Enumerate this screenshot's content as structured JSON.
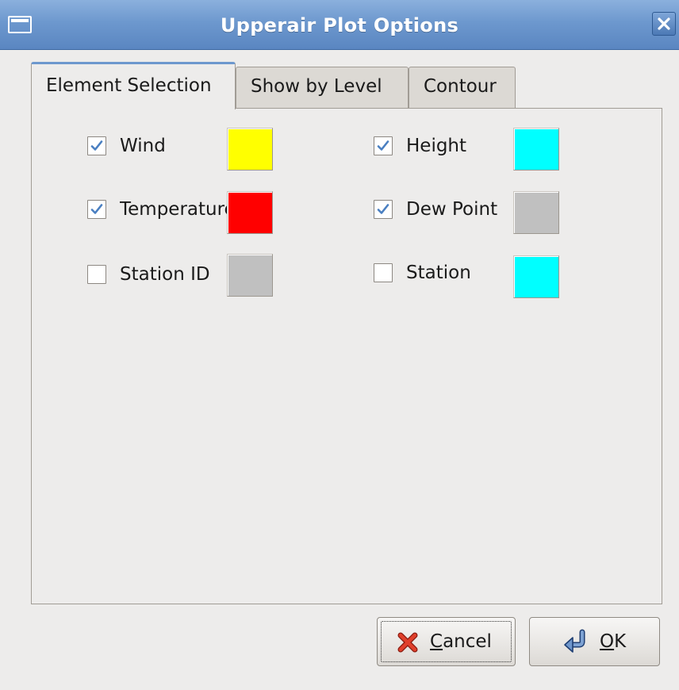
{
  "window": {
    "title": "Upperair Plot Options"
  },
  "tabs": [
    {
      "label": "Element Selection",
      "active": true
    },
    {
      "label": "Show by Level",
      "active": false
    },
    {
      "label": "Contour",
      "active": false
    }
  ],
  "options": [
    {
      "key": "wind",
      "label": "Wind",
      "checked": true,
      "color": "#ffff00"
    },
    {
      "key": "temperature",
      "label": "Temperature",
      "checked": true,
      "color": "#ff0000"
    },
    {
      "key": "station-id",
      "label": "Station ID",
      "checked": false,
      "color": "#c0c0c0"
    },
    {
      "key": "height",
      "label": "Height",
      "checked": true,
      "color": "#00ffff"
    },
    {
      "key": "dew-point",
      "label": "Dew Point",
      "checked": true,
      "color": "#c0c0c0"
    },
    {
      "key": "station",
      "label": "Station",
      "checked": false,
      "color": "#00ffff"
    }
  ],
  "buttons": {
    "cancel": {
      "mnemonic": "C",
      "rest": "ancel",
      "icon": "cancel-x-icon"
    },
    "ok": {
      "mnemonic": "O",
      "rest": "K",
      "icon": "ok-arrow-icon"
    }
  }
}
